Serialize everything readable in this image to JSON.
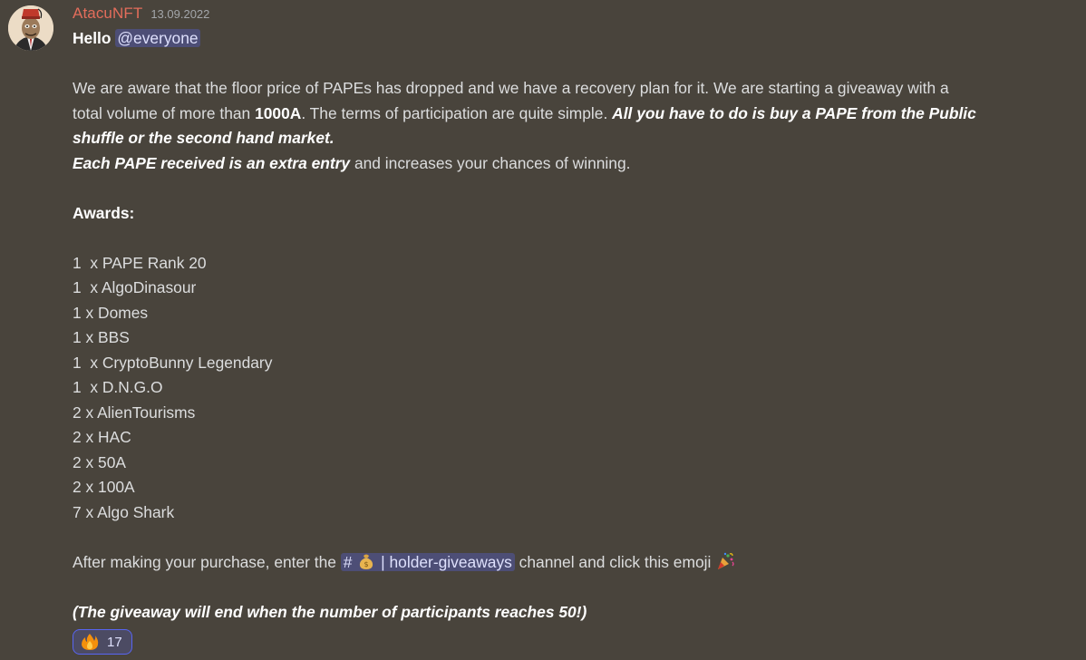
{
  "author": {
    "name": "AtacuNFT",
    "timestamp": "13.09.2022"
  },
  "message": {
    "greeting": "Hello",
    "mention": "@everyone",
    "p1_a": "We are aware that the floor price of PAPEs has dropped and we have a recovery plan for it. We are starting a giveaway with a",
    "p1_b": "total volume of more than ",
    "p1_b_bold": "1000A",
    "p1_b_rest": ". The terms of participation are quite simple. ",
    "p1_b_bi": "All you have to do is buy a PAPE from the Public",
    "p1_c_bi": "shuffle or the second hand market.",
    "p2_bi": "Each PAPE received is an extra entry",
    "p2_rest": " and increases your chances of winning.",
    "awards_heading": "Awards:",
    "awards": [
      "1  x PAPE Rank 20",
      "1  x AlgoDinasour",
      "1 x Domes",
      "1 x BBS",
      "1  x CryptoBunny Legendary",
      "1  x D.N.G.O",
      "2 x AlienTourisms",
      "2 x HAC",
      "2 x 50A",
      "2 x 100A",
      "7 x Algo Shark"
    ],
    "cta_before": "After making your purchase, enter the ",
    "channel_name": "| holder-giveaways",
    "cta_after": " channel and click this emoji",
    "footer_note": "(The giveaway will end when the number of participants reaches 50!)"
  },
  "reaction": {
    "emoji": "fire-icon",
    "count": "17"
  }
}
